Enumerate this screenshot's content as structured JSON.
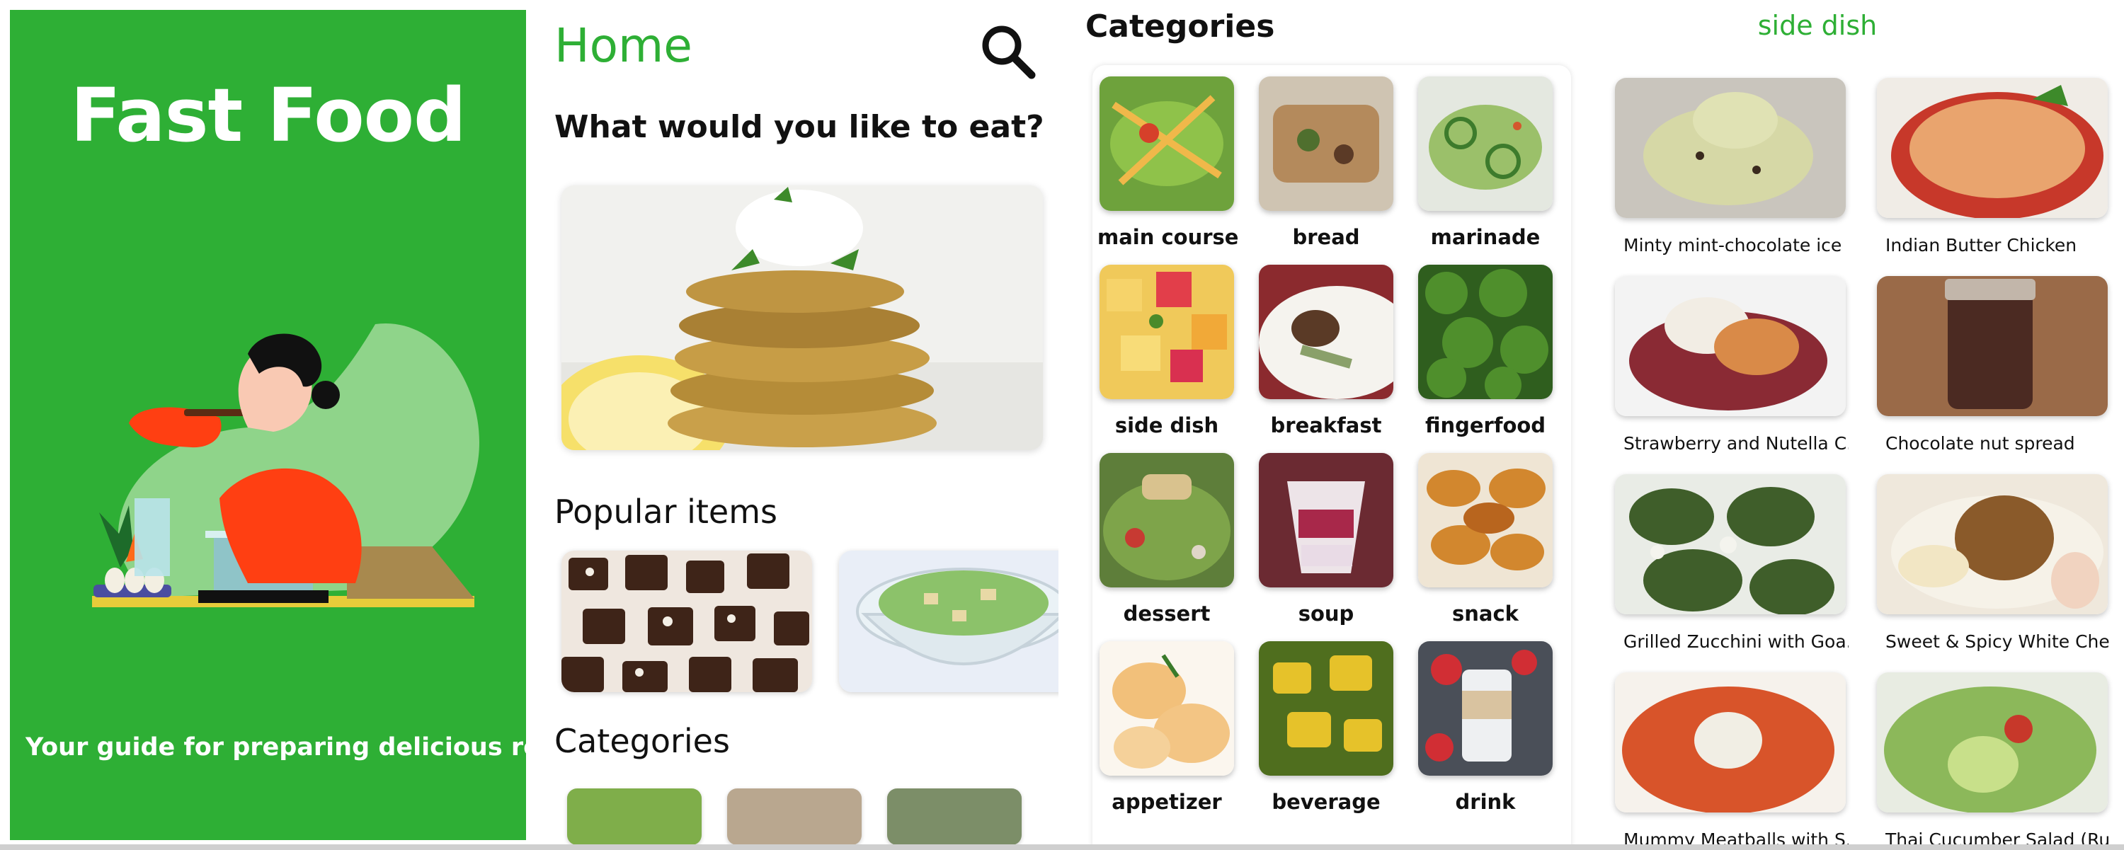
{
  "colors": {
    "brand_green": "#2eaf35",
    "text_dark": "#111111"
  },
  "splash": {
    "title": "Fast Food",
    "subtitle": "Your guide for preparing delicious recipes"
  },
  "home": {
    "title": "Home",
    "question": "What would you like to eat?",
    "popular_title": "Popular items",
    "categories_title": "Categories",
    "search_icon": "search-icon"
  },
  "categories": {
    "title": "Categories",
    "items": [
      {
        "label": "main course"
      },
      {
        "label": "bread"
      },
      {
        "label": "marinade"
      },
      {
        "label": "side dish"
      },
      {
        "label": "breakfast"
      },
      {
        "label": "fingerfood"
      },
      {
        "label": "dessert"
      },
      {
        "label": "soup"
      },
      {
        "label": "snack"
      },
      {
        "label": "appetizer"
      },
      {
        "label": "beverage"
      },
      {
        "label": "drink"
      }
    ]
  },
  "side_dish": {
    "title": "side dish",
    "recipes": [
      {
        "name": "Minty mint-chocolate ice ..."
      },
      {
        "name": "Indian Butter Chicken"
      },
      {
        "name": "Strawberry and Nutella C..."
      },
      {
        "name": "Chocolate nut spread"
      },
      {
        "name": "Grilled Zucchini with Goa..."
      },
      {
        "name": "Sweet & Spicy White Che..."
      },
      {
        "name": "Mummy Meatballs with S..."
      },
      {
        "name": "Thai Cucumber Salad (Ru..."
      }
    ]
  }
}
